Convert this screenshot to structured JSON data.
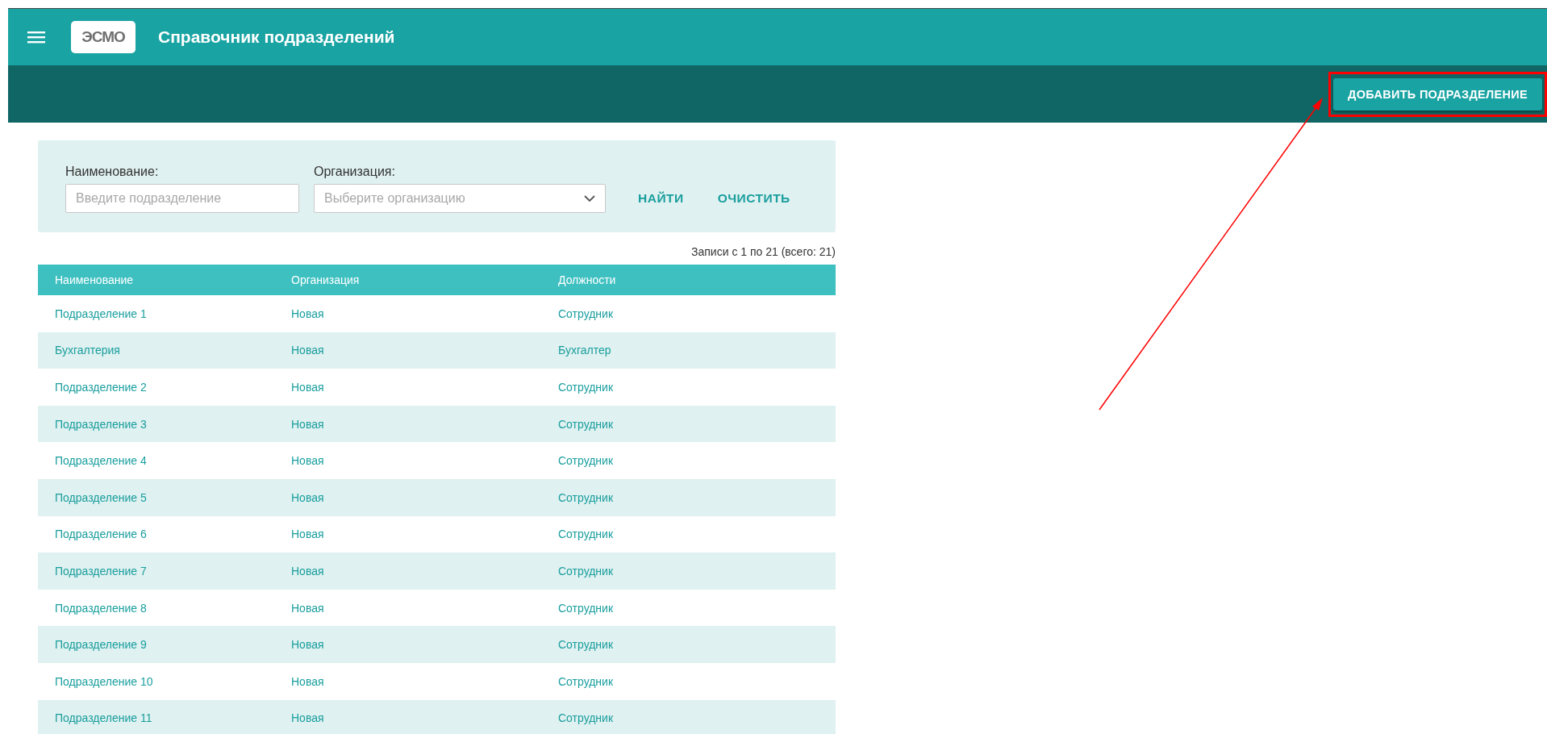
{
  "header": {
    "logo": "ЭСМО",
    "title": "Справочник подразделений"
  },
  "toolbar": {
    "add_button": "ДОБАВИТЬ ПОДРАЗДЕЛЕНИЕ"
  },
  "filter": {
    "name_label": "Наименование:",
    "name_placeholder": "Введите подразделение",
    "org_label": "Организация:",
    "org_placeholder": "Выберите организацию",
    "find_button": "НАЙТИ",
    "clear_button": "ОЧИСТИТЬ"
  },
  "records_info": "Записи с 1 по 21 (всего: 21)",
  "table": {
    "columns": [
      "Наименование",
      "Организация",
      "Должности"
    ],
    "rows": [
      {
        "name": "Подразделение 1",
        "organization": "Новая",
        "positions": "Сотрудник"
      },
      {
        "name": "Бухгалтерия",
        "organization": "Новая",
        "positions": "Бухгалтер"
      },
      {
        "name": "Подразделение 2",
        "organization": "Новая",
        "positions": "Сотрудник"
      },
      {
        "name": "Подразделение 3",
        "organization": "Новая",
        "positions": "Сотрудник"
      },
      {
        "name": "Подразделение 4",
        "organization": "Новая",
        "positions": "Сотрудник"
      },
      {
        "name": "Подразделение 5",
        "organization": "Новая",
        "positions": "Сотрудник"
      },
      {
        "name": "Подразделение 6",
        "organization": "Новая",
        "positions": "Сотрудник"
      },
      {
        "name": "Подразделение 7",
        "organization": "Новая",
        "positions": "Сотрудник"
      },
      {
        "name": "Подразделение 8",
        "organization": "Новая",
        "positions": "Сотрудник"
      },
      {
        "name": "Подразделение 9",
        "organization": "Новая",
        "positions": "Сотрудник"
      },
      {
        "name": "Подразделение 10",
        "organization": "Новая",
        "positions": "Сотрудник"
      },
      {
        "name": "Подразделение 11",
        "organization": "Новая",
        "positions": "Сотрудник"
      }
    ]
  }
}
